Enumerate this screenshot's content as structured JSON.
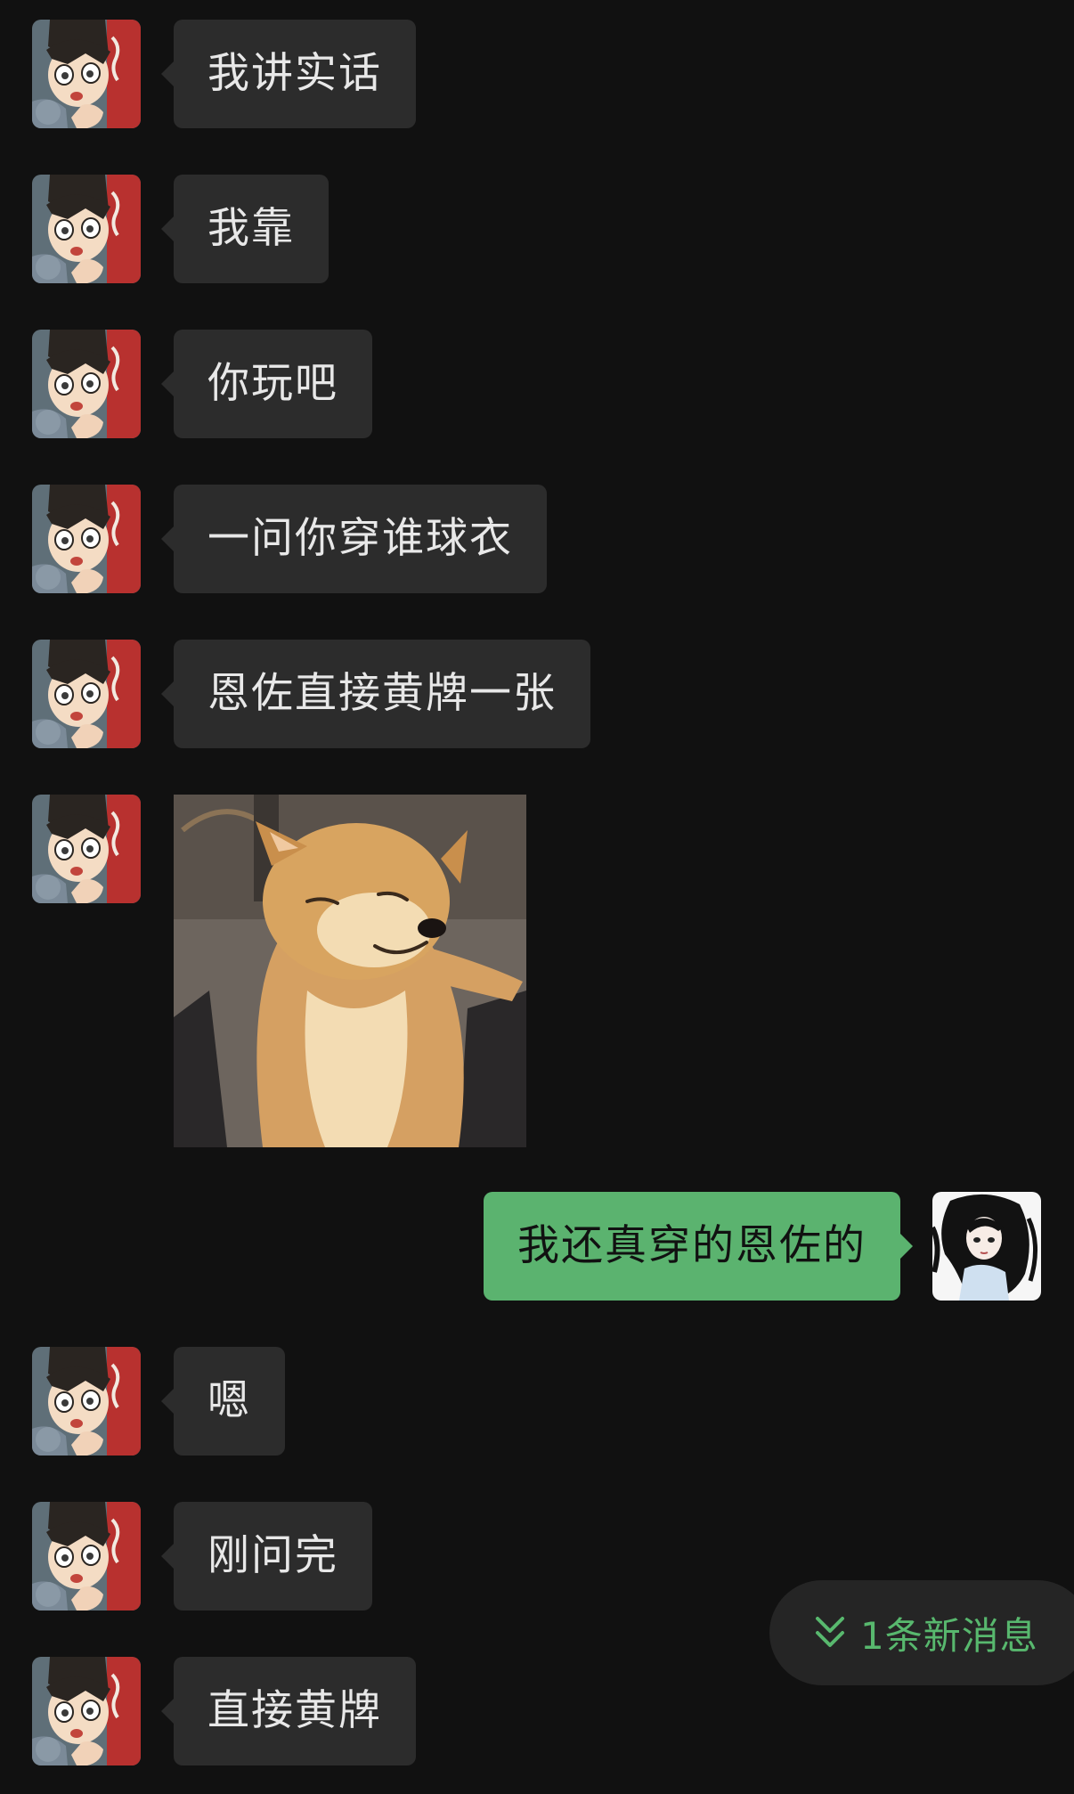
{
  "messages": [
    {
      "side": "in",
      "type": "text",
      "text": "我讲实话"
    },
    {
      "side": "in",
      "type": "text",
      "text": "我靠"
    },
    {
      "side": "in",
      "type": "text",
      "text": "你玩吧"
    },
    {
      "side": "in",
      "type": "text",
      "text": "一问你穿谁球衣"
    },
    {
      "side": "in",
      "type": "text",
      "text": "恩佐直接黄牌一张"
    },
    {
      "side": "in",
      "type": "sticker",
      "sticker": "shiba-inu-smug-sticker"
    },
    {
      "side": "out",
      "type": "text",
      "text": "我还真穿的恩佐的"
    },
    {
      "side": "in",
      "type": "text",
      "text": "嗯"
    },
    {
      "side": "in",
      "type": "text",
      "text": "刚问完"
    },
    {
      "side": "in",
      "type": "text",
      "text": "直接黄牌"
    }
  ],
  "new_message_pill": {
    "label": "1条新消息",
    "icon": "double-chevron-down-icon"
  },
  "colors": {
    "background": "#111111",
    "incoming_bubble": "#2c2c2c",
    "outgoing_bubble": "#5bb36f",
    "accent_green": "#58b86e"
  },
  "avatars": {
    "incoming": "anime-boy-avatar",
    "outgoing": "anime-girl-avatar"
  }
}
